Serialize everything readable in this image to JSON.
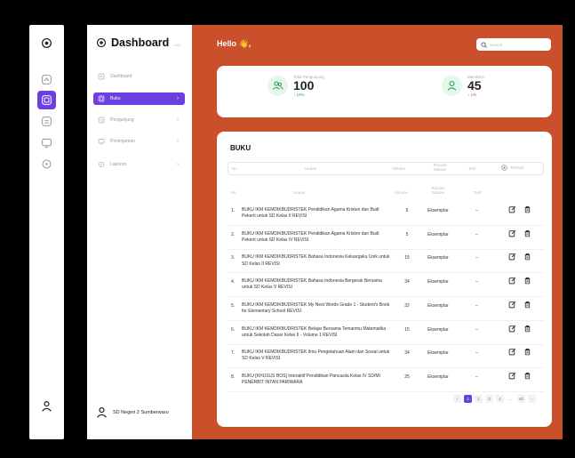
{
  "brand": {
    "title": "Dashboard",
    "sub": "v.01"
  },
  "sidebar": {
    "items": [
      {
        "label": "Dashboard",
        "icon": "dashboard-icon"
      },
      {
        "label": "Buku",
        "icon": "book-icon"
      },
      {
        "label": "Pengunjung",
        "icon": "visitor-icon"
      },
      {
        "label": "Peminjaman",
        "icon": "loan-icon"
      },
      {
        "label": "Laporan",
        "icon": "report-icon"
      }
    ],
    "user": "SD Negeri 2 Sumberwaru"
  },
  "header": {
    "greeting": "Hello 👋,",
    "search_placeholder": "Search"
  },
  "stats": [
    {
      "label": "Total Pengunjung",
      "value": "100",
      "trend": "↑ 10%",
      "trend_dir": "up"
    },
    {
      "label": "Members",
      "value": "45",
      "trend": "↓ 1%",
      "trend_dir": "down"
    }
  ],
  "table": {
    "title": "BUKU",
    "headers": {
      "no": "No",
      "uraian": "Uraian",
      "volume": "Volume",
      "satuan": "Rincian Satuan",
      "tarif": "Tarif",
      "add": "Tambah"
    },
    "rows": [
      {
        "no": "1.",
        "uraian": "BUKU IKM KEMDIKBUDRISTEK Pendidikan Agama Kristen dan Budi Pekerti untuk SD Kelas II REVISI",
        "volume": "5",
        "satuan": "Eksemplar",
        "tarif": "–"
      },
      {
        "no": "2.",
        "uraian": "BUKU IKM KEMDIKBUDRISTEK Pendidikan Agama Kristen dan Budi Pekerti untuk SD Kelas IV REVISI",
        "volume": "5",
        "satuan": "Eksemplar",
        "tarif": "–"
      },
      {
        "no": "3.",
        "uraian": "BUKU IKM KEMDIKBUDRISTEK Bahasa Indonesia Keluargaku Unik untuk SD Kelas II REVISI",
        "volume": "15",
        "satuan": "Eksemplar",
        "tarif": "–"
      },
      {
        "no": "4.",
        "uraian": "BUKU IKM KEMDIKBUDRISTEK Bahasa Indonesia Bergerak Bersama untuk SD Kelas V REVISI",
        "volume": "34",
        "satuan": "Eksemplar",
        "tarif": "–"
      },
      {
        "no": "5.",
        "uraian": "BUKU IKM KEMDIKBUDRISTEK My Next Words Grade 1 - Student's Book for Elementary School REVISI",
        "volume": "32",
        "satuan": "Eksemplar",
        "tarif": "–"
      },
      {
        "no": "6.",
        "uraian": "BUKU IKM KEMDIKBUDRISTEK Belajar Bersama Temanmu Matematika untuk Sekolah Dasar Kelas II - Volume 1 REVISI",
        "volume": "15",
        "satuan": "Eksemplar",
        "tarif": "–"
      },
      {
        "no": "7.",
        "uraian": "BUKU IKM KEMDIKBUDRISTEK Ilmu Pengetahuan Alam dan Sosial untuk SD Kelas V REVISI",
        "volume": "34",
        "satuan": "Eksemplar",
        "tarif": "–"
      },
      {
        "no": "8.",
        "uraian": "BUKU [KHUSUS BOS] Interaktif Pendidikan Pancasila Kelas IV SD/MI PENERBIT INTAN PARIWARA",
        "volume": "25",
        "satuan": "Eksemplar",
        "tarif": "–"
      }
    ],
    "pagination": [
      "‹",
      "1",
      "2",
      "3",
      "4",
      "...",
      "40",
      "›"
    ],
    "active_page": "1"
  },
  "colors": {
    "accent": "#6b3fe0",
    "main_bg": "#c9502b",
    "up": "#2a9d5c",
    "down": "#d23c3c"
  }
}
